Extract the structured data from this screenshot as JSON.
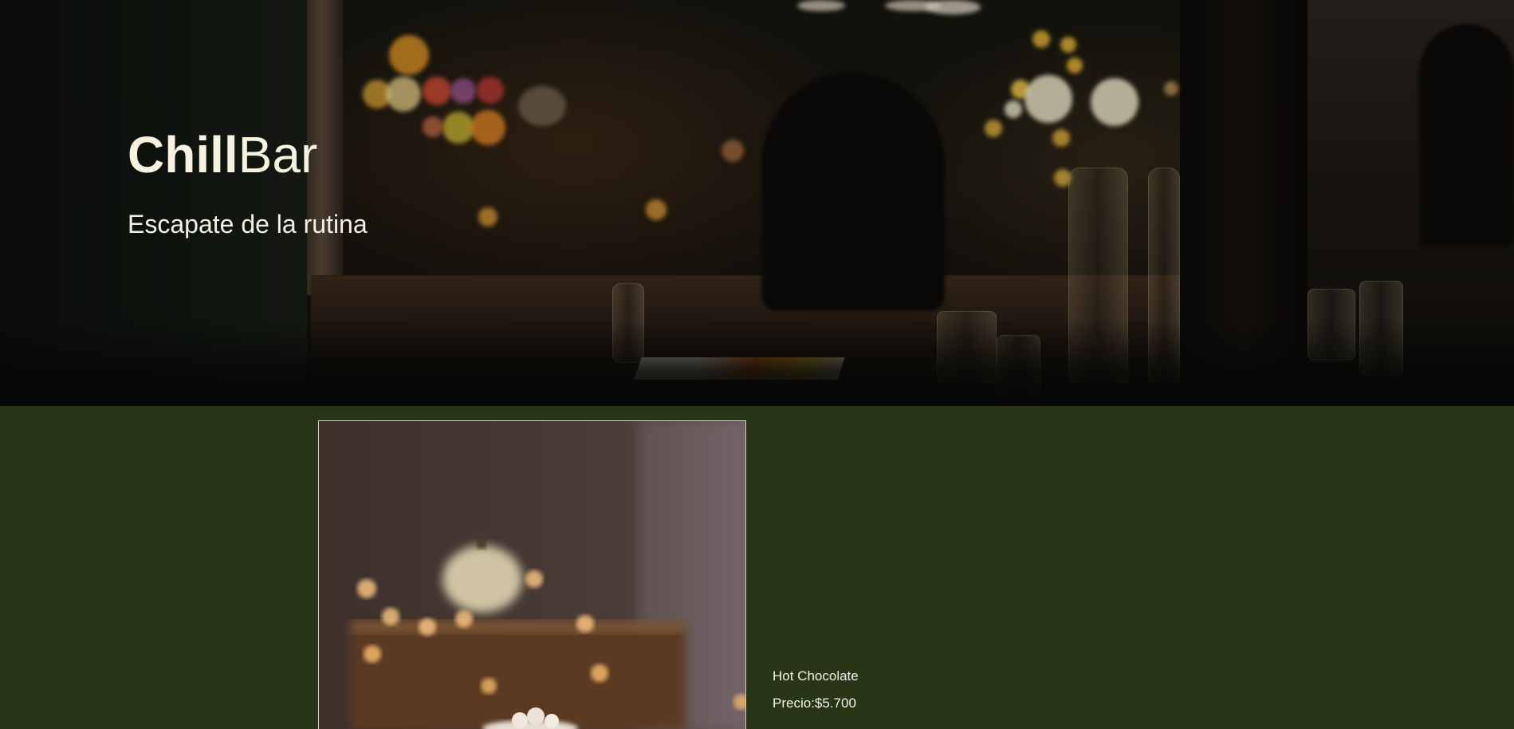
{
  "hero": {
    "brand_strong": "Chill",
    "brand_light": "Bar",
    "tagline": "Escapate de la rutina"
  },
  "product": {
    "name": "Hot Chocolate",
    "price_label": "Precio:",
    "price_value": "$5.700"
  },
  "colors": {
    "page_background": "#283617",
    "hero_text": "#f6f2df",
    "card_border": "#cfcfc5"
  }
}
